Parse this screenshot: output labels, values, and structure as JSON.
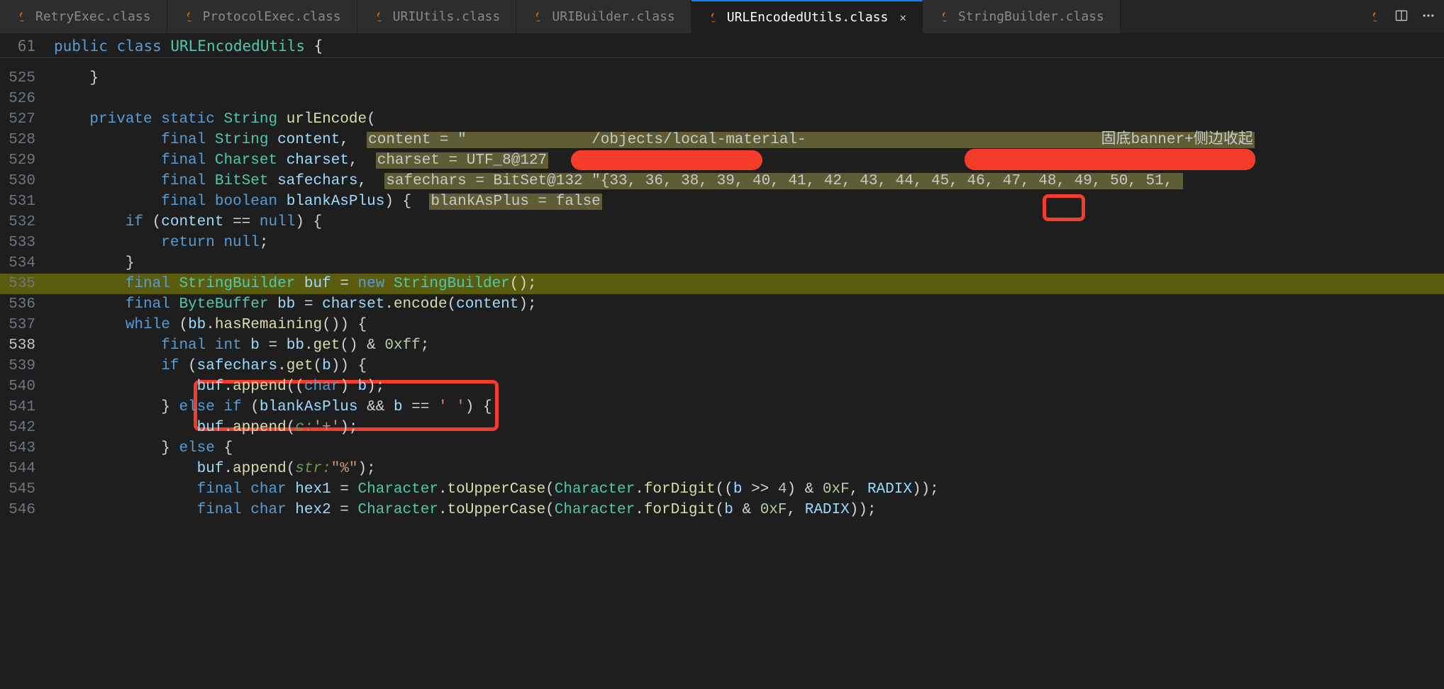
{
  "tabs": [
    {
      "label": "RetryExec.class"
    },
    {
      "label": "ProtocolExec.class"
    },
    {
      "label": "URIUtils.class"
    },
    {
      "label": "URIBuilder.class"
    },
    {
      "label": "URLEncodedUtils.class",
      "active": true
    },
    {
      "label": "StringBuilder.class"
    }
  ],
  "sticky": {
    "line_no": "61",
    "code_prefix": "public ",
    "kw_class": "class ",
    "type": "URLEncodedUtils ",
    "brace": "{"
  },
  "lines": {
    "l525": {
      "no": "525",
      "brace": "}"
    },
    "l526": {
      "no": "526"
    },
    "l527": {
      "no": "527",
      "kw1": "private ",
      "kw2": "static ",
      "type": "String ",
      "fn": "urlEncode",
      "p": "("
    },
    "l528": {
      "no": "528",
      "kw": "final ",
      "type": "String ",
      "var": "content",
      "comma": ",  ",
      "inlay": "content = \"",
      "inlay2": "/objects/local-material-",
      "inlay3": "固底banner+侧边收起"
    },
    "l529": {
      "no": "529",
      "kw": "final ",
      "type": "Charset ",
      "var": "charset",
      "comma": ",  ",
      "inlay": "charset = UTF_8@127"
    },
    "l530": {
      "no": "530",
      "kw": "final ",
      "type": "BitSet ",
      "var": "safechars",
      "comma": ",  ",
      "inlay": "safechars = BitSet@132 \"{33, 36, 38, 39, 40, 41, 42, ",
      "hlnum": "43,",
      "inlay_tail": " 44, 45, 46, 47, 48, 49, 50, 51, "
    },
    "l531": {
      "no": "531",
      "kw": "final ",
      "type": "boolean ",
      "var": "blankAsPlus",
      "p": ") {  ",
      "inlay": "blankAsPlus = false"
    },
    "l532": {
      "no": "532",
      "kw": "if ",
      "p1": "(",
      "var": "content ",
      "op": "== ",
      "kw2": "null",
      "p2": ") {"
    },
    "l533": {
      "no": "533",
      "kw": "return ",
      "kw2": "null",
      "p": ";"
    },
    "l534": {
      "no": "534",
      "brace": "}"
    },
    "l535": {
      "no": "535",
      "kw": "final ",
      "type": "StringBuilder ",
      "var": "buf ",
      "op": "= ",
      "kw2": "new ",
      "type2": "StringBuilder",
      "p": "();"
    },
    "l536": {
      "no": "536",
      "kw": "final ",
      "type": "ByteBuffer ",
      "var": "bb ",
      "op": "= ",
      "var2": "charset",
      "p": ".",
      "fn": "encode",
      "p2": "(",
      "var3": "content",
      "p3": ");"
    },
    "l537": {
      "no": "537",
      "kw": "while ",
      "p": "(",
      "var": "bb",
      "dot": ".",
      "fn": "hasRemaining",
      "p2": "()) {"
    },
    "l538": {
      "no": "538",
      "kw": "final ",
      "type": "int ",
      "var": "b ",
      "op": "= ",
      "var2": "bb",
      "dot": ".",
      "fn": "get",
      "p": "() & ",
      "num": "0xff",
      "p2": ";"
    },
    "l539": {
      "no": "539",
      "kw": "if ",
      "p": "(",
      "var": "safechars",
      "dot": ".",
      "fn": "get",
      "p2": "(",
      "var2": "b",
      "p3": ")) {"
    },
    "l540": {
      "no": "540",
      "var": "buf",
      "dot": ".",
      "fn": "append",
      "p": "((",
      "kw": "char",
      "p2": ") ",
      "var2": "b",
      "p3": ");"
    },
    "l541": {
      "no": "541",
      "p": "} ",
      "kw": "else if ",
      "p2": "(",
      "var": "blankAsPlus ",
      "op": "&& ",
      "var2": "b ",
      "op2": "== ",
      "str": "' '",
      "p3": ") {"
    },
    "l542": {
      "no": "542",
      "var": "buf",
      "dot": ".",
      "fn": "append",
      "p": "(",
      "parm": "c:",
      "str": "'+'",
      "p2": ");"
    },
    "l543": {
      "no": "543",
      "p": "} ",
      "kw": "else ",
      "p2": "{"
    },
    "l544": {
      "no": "544",
      "var": "buf",
      "dot": ".",
      "fn": "append",
      "p": "(",
      "parm": "str:",
      "str": "\"%\"",
      "p2": ");"
    },
    "l545": {
      "no": "545",
      "kw": "final ",
      "type": "char ",
      "var": "hex1 ",
      "op": "= ",
      "type2": "Character",
      "dot": ".",
      "fn": "toUpperCase",
      "p": "(",
      "type3": "Character",
      "dot2": ".",
      "fn2": "forDigit",
      "p2": "((",
      "var2": "b ",
      "op2": ">> ",
      "num": "4",
      "p3": ") & ",
      "num2": "0xF",
      "p4": ", ",
      "var3": "RADIX",
      "p5": "));"
    },
    "l546": {
      "no": "546",
      "kw": "final ",
      "type": "char ",
      "var": "hex2 ",
      "op": "= ",
      "type2": "Character",
      "dot": ".",
      "fn": "toUpperCase",
      "p": "(",
      "type3": "Character",
      "dot2": ".",
      "fn2": "forDigit",
      "p2": "(",
      "var2": "b ",
      "op2": "& ",
      "num2": "0xF",
      "p4": ", ",
      "var3": "RADIX",
      "p5": "));"
    }
  }
}
